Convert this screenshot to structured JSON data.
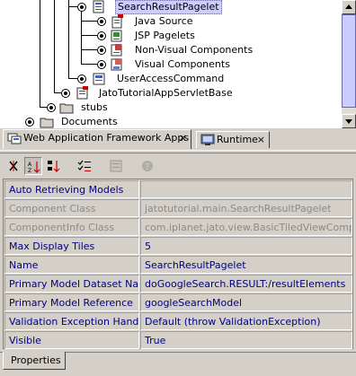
{
  "tree": {
    "nodes": [
      {
        "label": "SearchResultPagelet",
        "icon": "pagelet-icon",
        "state": "expanded",
        "selected": true
      },
      {
        "label": "Java Source",
        "icon": "java-source-icon",
        "state": "collapsed"
      },
      {
        "label": "JSP Pagelets",
        "icon": "jsp-pagelets-icon",
        "state": "collapsed"
      },
      {
        "label": "Non-Visual Components",
        "icon": "non-visual-components-icon",
        "state": "collapsed"
      },
      {
        "label": "Visual Components",
        "icon": "visual-components-icon",
        "state": "collapsed"
      },
      {
        "label": "UserAccessCommand",
        "icon": "command-icon",
        "state": "collapsed"
      },
      {
        "label": "JatoTutorialAppServletBase",
        "icon": "class-icon",
        "state": "collapsed"
      },
      {
        "label": "stubs",
        "icon": "folder-icon",
        "state": "collapsed"
      },
      {
        "label": "Documents",
        "icon": "folder-icon",
        "state": "collapsed"
      }
    ]
  },
  "explorer_tabs": [
    {
      "label": "Web Application Framework Apps",
      "icon": "web-app-framework-icon",
      "active": true
    },
    {
      "label": "Runtime",
      "icon": "runtime-icon",
      "active": false
    }
  ],
  "toolbar": {
    "buttons": [
      {
        "name": "unsorted-icon",
        "pressed": false
      },
      {
        "name": "sort-by-name-icon",
        "pressed": true
      },
      {
        "name": "sort-by-type-icon",
        "pressed": false
      },
      {
        "name": "show-editable-only-icon",
        "pressed": false
      },
      {
        "name": "customizer-icon",
        "pressed": false,
        "disabled": true
      },
      {
        "name": "help-icon",
        "pressed": false,
        "disabled": true
      }
    ]
  },
  "properties": [
    {
      "name": "Auto Retrieving Models",
      "value": "",
      "disabled": false
    },
    {
      "name": "Component Class",
      "value": "jatotutorial.main.SearchResultPagelet",
      "disabled": true
    },
    {
      "name": "ComponentInfo Class",
      "value": "com.iplanet.jato.view.BasicTiledViewComponent",
      "disabled": true
    },
    {
      "name": "Max Display Tiles",
      "value": "5",
      "disabled": false
    },
    {
      "name": "Name",
      "value": "SearchResultPagelet",
      "disabled": false
    },
    {
      "name": "Primary Model Dataset Name",
      "value": "doGoogleSearch.RESULT:/resultElements",
      "disabled": false
    },
    {
      "name": "Primary Model Reference",
      "value": "googleSearchModel",
      "disabled": false
    },
    {
      "name": "Validation Exception Handler",
      "value": "Default (throw ValidationException)",
      "disabled": false
    },
    {
      "name": "Visible",
      "value": "True",
      "disabled": false
    }
  ],
  "bottom_tabs": [
    {
      "label": "Properties",
      "active": true
    }
  ],
  "colors": {
    "selection": "#ccccff",
    "property_text": "#000080",
    "disabled_text": "#8a8a8a"
  }
}
